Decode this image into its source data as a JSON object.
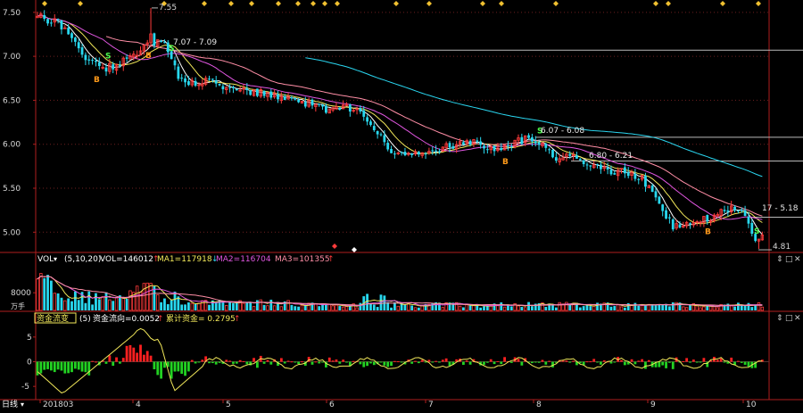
{
  "colors": {
    "background": "#000000",
    "up": "#ff3b3b",
    "down": "#28d8ef",
    "frame": "#b01e1e",
    "grid": "#6e1f1f",
    "ma_white": "#ffffff",
    "ma_yellow": "#f2e85a",
    "ma_magenta": "#e056e0",
    "ma_pink": "#ff8ea6",
    "ma_cyan": "#2ad6f0",
    "hline": "#b8b8b8",
    "green": "#22d222",
    "red": "#ff2020",
    "marker_orange": "#ff9a1a",
    "marker_green": "#4cff4c",
    "axis_text": "#d8d8d8"
  },
  "top_markers": {
    "icon": "diamond-icon",
    "count": 20,
    "color": "#f0c030"
  },
  "price_panel": {
    "y_ticks": [
      "7.50",
      "7.00",
      "6.50",
      "6.00",
      "5.50",
      "5.00"
    ],
    "y_range": [
      4.78,
      7.62
    ],
    "annotations": {
      "high": "7.55",
      "low": "4.81",
      "band_a": "7.07 - 7.09",
      "band_b": "6.07 - 6.08",
      "band_c": "6.80 - 6.21",
      "band_d": "17 - 5.18"
    },
    "signals": [
      {
        "label": "B",
        "type": "buy",
        "x": 108
      },
      {
        "label": "S",
        "type": "sell",
        "x": 121
      },
      {
        "label": "B",
        "type": "buy",
        "x": 166
      },
      {
        "label": "S",
        "type": "sell",
        "x": 192
      },
      {
        "label": "B",
        "type": "buy",
        "x": 566
      },
      {
        "label": "S",
        "type": "sell",
        "x": 605
      },
      {
        "label": "B",
        "type": "buy",
        "x": 793
      },
      {
        "label": "S",
        "type": "sell",
        "x": 848
      }
    ]
  },
  "vol_panel": {
    "header": {
      "name": "VOL",
      "params": "(5,10,20)",
      "vol": "VOL=146012",
      "ma1": "MA1=117918",
      "ma2": "MA2=116704",
      "ma3": "MA3=101355"
    },
    "y_ticks": [
      "8000",
      "万手"
    ],
    "y_max": 21000
  },
  "ind_panel": {
    "header": {
      "name": "资金流变",
      "params": "(5)",
      "v1": "资金流向=0.0052",
      "v2": "累计资金= 0.2795"
    },
    "y_ticks": [
      "5",
      "0",
      "-5"
    ],
    "y_range": [
      -7.5,
      7.5
    ]
  },
  "panel_controls": [
    "⇕",
    "□",
    "✕"
  ],
  "x_axis": {
    "corner": "日线",
    "labels": [
      {
        "text": "201803",
        "x": 48
      },
      {
        "text": "4",
        "x": 152
      },
      {
        "text": "5",
        "x": 253
      },
      {
        "text": "6",
        "x": 369
      },
      {
        "text": "7",
        "x": 480
      },
      {
        "text": "8",
        "x": 601
      },
      {
        "text": "9",
        "x": 729
      },
      {
        "text": "10",
        "x": 836
      }
    ]
  },
  "chart_data": {
    "type": "candlestick",
    "x": [
      "201803",
      "4",
      "5",
      "6",
      "7",
      "8",
      "9",
      "10"
    ],
    "price_ylim": [
      4.78,
      7.62
    ],
    "price_anchors": [
      {
        "x": 42,
        "y": 7.45
      },
      {
        "x": 60,
        "y": 7.4
      },
      {
        "x": 78,
        "y": 7.28
      },
      {
        "x": 96,
        "y": 7.0
      },
      {
        "x": 112,
        "y": 6.85
      },
      {
        "x": 132,
        "y": 6.9
      },
      {
        "x": 150,
        "y": 7.05
      },
      {
        "x": 168,
        "y": 7.18
      },
      {
        "x": 185,
        "y": 7.12
      },
      {
        "x": 200,
        "y": 6.78
      },
      {
        "x": 215,
        "y": 6.7
      },
      {
        "x": 235,
        "y": 6.72
      },
      {
        "x": 258,
        "y": 6.62
      },
      {
        "x": 285,
        "y": 6.6
      },
      {
        "x": 310,
        "y": 6.55
      },
      {
        "x": 340,
        "y": 6.48
      },
      {
        "x": 365,
        "y": 6.4
      },
      {
        "x": 390,
        "y": 6.42
      },
      {
        "x": 410,
        "y": 6.3
      },
      {
        "x": 425,
        "y": 6.1
      },
      {
        "x": 440,
        "y": 5.9
      },
      {
        "x": 460,
        "y": 5.88
      },
      {
        "x": 480,
        "y": 5.9
      },
      {
        "x": 500,
        "y": 5.97
      },
      {
        "x": 520,
        "y": 6.02
      },
      {
        "x": 540,
        "y": 6.0
      },
      {
        "x": 555,
        "y": 5.9
      },
      {
        "x": 570,
        "y": 5.98
      },
      {
        "x": 590,
        "y": 6.07
      },
      {
        "x": 605,
        "y": 6.02
      },
      {
        "x": 620,
        "y": 5.85
      },
      {
        "x": 640,
        "y": 5.85
      },
      {
        "x": 660,
        "y": 5.8
      },
      {
        "x": 680,
        "y": 5.7
      },
      {
        "x": 700,
        "y": 5.68
      },
      {
        "x": 720,
        "y": 5.6
      },
      {
        "x": 740,
        "y": 5.3
      },
      {
        "x": 755,
        "y": 5.05
      },
      {
        "x": 770,
        "y": 5.08
      },
      {
        "x": 790,
        "y": 5.15
      },
      {
        "x": 805,
        "y": 5.2
      },
      {
        "x": 820,
        "y": 5.28
      },
      {
        "x": 835,
        "y": 5.22
      },
      {
        "x": 848,
        "y": 4.88
      },
      {
        "x": 860,
        "y": 4.98
      }
    ],
    "hlines": [
      {
        "label": "7.07 - 7.09",
        "value": 7.07
      },
      {
        "label": "6.07 - 6.08",
        "value": 6.08
      },
      {
        "label": "6.80 - 6.21",
        "value": 5.81
      },
      {
        "label": "17 - 5.18",
        "value": 5.17
      }
    ],
    "high": 7.55,
    "low": 4.81,
    "series": [
      {
        "name": "VOL"
      },
      {
        "name": "MA1"
      },
      {
        "name": "MA2"
      },
      {
        "name": "MA3"
      }
    ]
  }
}
